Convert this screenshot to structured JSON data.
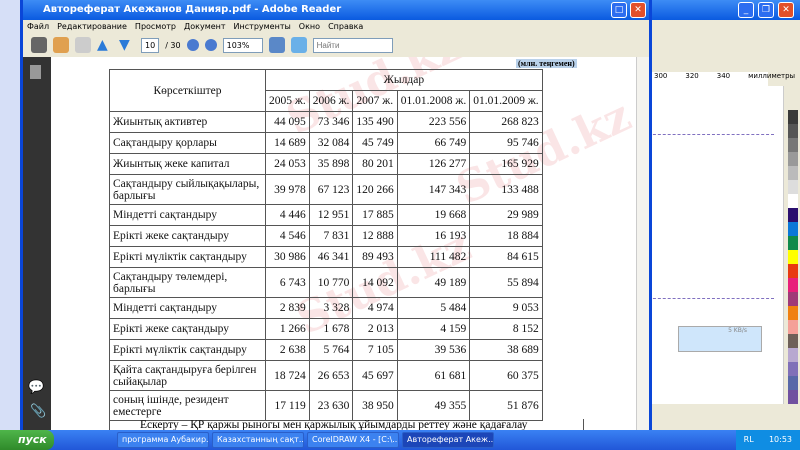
{
  "reader": {
    "title": "Автореферат Акежанов Данияр.pdf - Adobe Reader",
    "menu": [
      "Файл",
      "Редактирование",
      "Просмотр",
      "Документ",
      "Инструменты",
      "Окно",
      "Справка"
    ],
    "page_current": "10",
    "page_total": "/ 30",
    "zoom": "103%",
    "search_placeholder": "Найти"
  },
  "document": {
    "unit": "(млн. теңгемен)",
    "col_indicator": "Көрсеткіштер",
    "col_years": "Жылдар",
    "years": [
      "2005 ж.",
      "2006 ж.",
      "2007 ж.",
      "01.01.2008 ж.",
      "01.01.2009 ж."
    ],
    "rows": [
      {
        "label": "Жиынтық активтер",
        "values": [
          "44 095",
          "73 346",
          "135 490",
          "223 556",
          "268 823"
        ]
      },
      {
        "label": "Сақтандыру қорлары",
        "values": [
          "14 689",
          "32 084",
          "45 749",
          "66 749",
          "95 746"
        ]
      },
      {
        "label": "Жиынтық жеке капитал",
        "values": [
          "24 053",
          "35 898",
          "80 201",
          "126 277",
          "165 929"
        ]
      },
      {
        "label": "Сақтандыру сыйлықақылары, барлығы",
        "values": [
          "39 978",
          "67 123",
          "120 266",
          "147 343",
          "133 488"
        ]
      },
      {
        "label": "Міндетті сақтандыру",
        "values": [
          "4 446",
          "12 951",
          "17 885",
          "19 668",
          "29 989"
        ]
      },
      {
        "label": "Ерікті жеке сақтандыру",
        "values": [
          "4 546",
          "7 831",
          "12 888",
          "16 193",
          "18 884"
        ]
      },
      {
        "label": "Ерікті мүліктік сақтандыру",
        "values": [
          "30 986",
          "46 341",
          "89 493",
          "111 482",
          "84 615"
        ]
      },
      {
        "label": "Сақтандыру төлемдері, барлығы",
        "values": [
          "6 743",
          "10 770",
          "14 092",
          "49 189",
          "55 894"
        ]
      },
      {
        "label": "Міндетті сақтандыру",
        "values": [
          "2 839",
          "3 328",
          "4 974",
          "5 484",
          "9 053"
        ]
      },
      {
        "label": "Ерікті жеке сақтандыру",
        "values": [
          "1 266",
          "1 678",
          "2 013",
          "4 159",
          "8 152"
        ]
      },
      {
        "label": "Ерікті мүліктік сақтандыру",
        "values": [
          "2 638",
          "5 764",
          "7 105",
          "39 536",
          "38 689"
        ]
      },
      {
        "label": "Қайта сақтандыруға берілген сыйақылар",
        "values": [
          "18 724",
          "26 653",
          "45 697",
          "61 681",
          "60 375"
        ]
      },
      {
        "label": "соның ішінде, резидент еместерге",
        "values": [
          "17 119",
          "23 630",
          "38 950",
          "49 355",
          "51 876"
        ]
      }
    ],
    "note": "Ескерту – ҚР қаржы рыногы мен қаржылық ұйымдарды реттеу және қадағалау",
    "watermark": "Stud.kz"
  },
  "corel": {
    "ruler": [
      "300",
      "320",
      "340",
      "миллиметры"
    ],
    "speed": "5 KB/s",
    "palette": [
      "#3a3a3a",
      "#555",
      "#777",
      "#999",
      "#bbb",
      "#ddd",
      "#fff",
      "#2a0f6e",
      "#0a78d8",
      "#0f8a4a",
      "#ffff00",
      "#e83a10",
      "#e8207a",
      "#a03a78",
      "#f08010",
      "#f4a098",
      "#6e6058",
      "#b8a8d0",
      "#8070b8",
      "#5868a8",
      "#7050a0"
    ]
  },
  "taskbar": {
    "start": "пуск",
    "tasks": [
      "программа Аубакир...",
      "Казахстанның сақт...",
      "CorelDRAW X4 - [C:\\...",
      "Автореферат Акеж..."
    ],
    "lang": "RL",
    "clock": "10:53"
  }
}
